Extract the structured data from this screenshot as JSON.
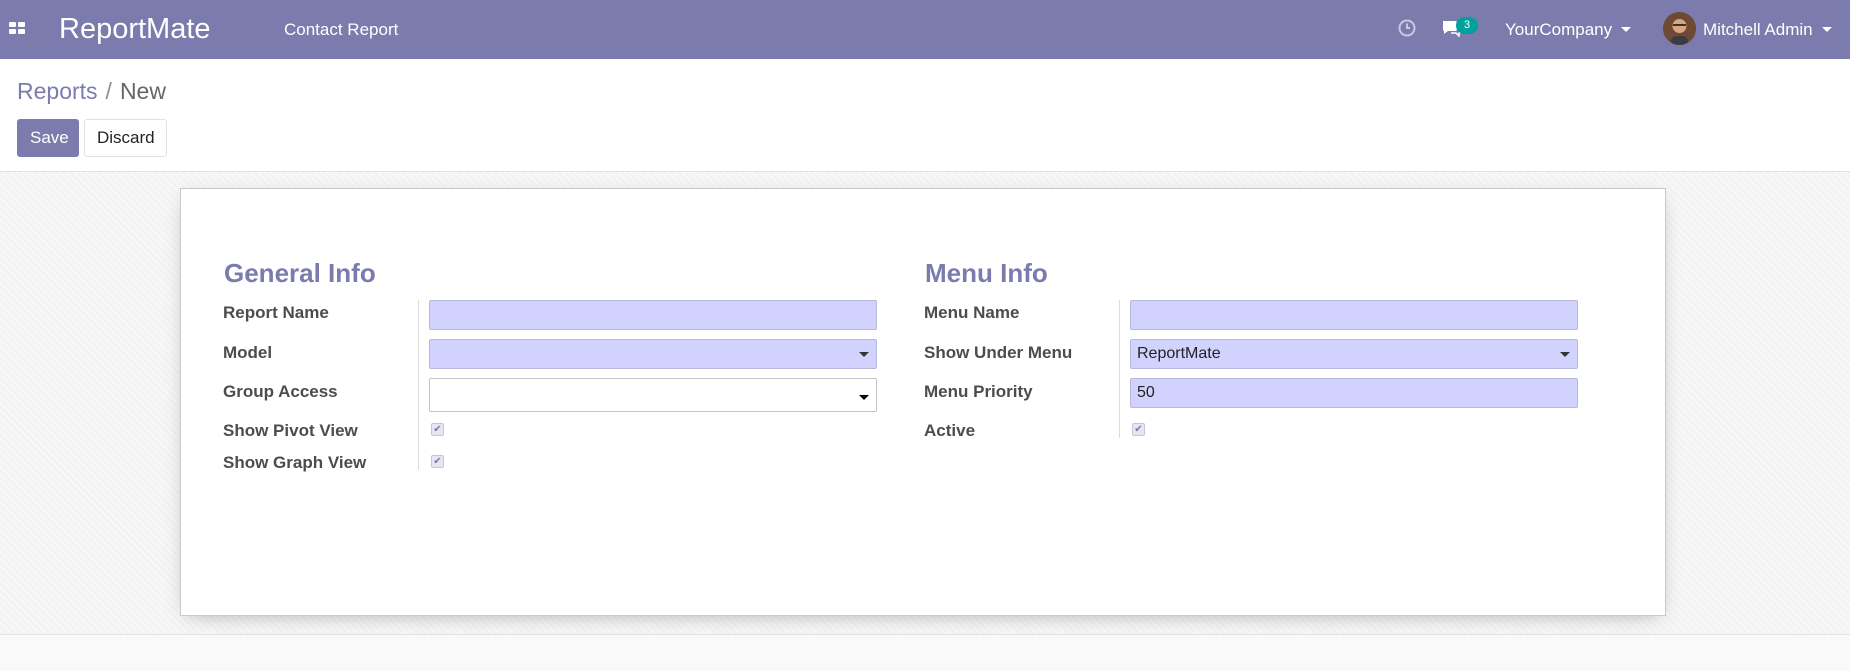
{
  "navbar": {
    "app_name": "ReportMate",
    "menu_item": "Contact Report",
    "chat_badge": "3",
    "company": "YourCompany",
    "user": "Mitchell Admin",
    "icons": {
      "apps": "apps-grid-icon",
      "activity": "clock-icon",
      "messages": "chat-icon"
    }
  },
  "breadcrumb": {
    "parent": "Reports",
    "separator": "/",
    "current": "New"
  },
  "buttons": {
    "save": "Save",
    "discard": "Discard"
  },
  "general_info": {
    "title": "General Info",
    "report_name_label": "Report Name",
    "report_name_value": "",
    "model_label": "Model",
    "model_value": "",
    "group_access_label": "Group Access",
    "group_access_value": "",
    "show_pivot_label": "Show Pivot View",
    "show_pivot_checked": true,
    "show_graph_label": "Show Graph View",
    "show_graph_checked": true
  },
  "menu_info": {
    "title": "Menu Info",
    "menu_name_label": "Menu Name",
    "menu_name_value": "",
    "show_under_label": "Show Under Menu",
    "show_under_value": "ReportMate",
    "priority_label": "Menu Priority",
    "priority_value": "50",
    "active_label": "Active",
    "active_checked": true
  },
  "colors": {
    "brand": "#7c7bad",
    "required_field": "#d2d2ff",
    "badge": "#00a09d"
  }
}
